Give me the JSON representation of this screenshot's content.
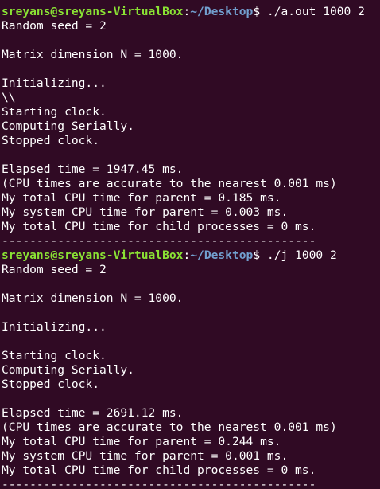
{
  "colors": {
    "background": "#300a24",
    "text": "#ffffff",
    "prompt_user": "#8ae234",
    "prompt_path": "#729fcf"
  },
  "terminal": {
    "runs": [
      {
        "prompt": {
          "user_host": "sreyans@sreyans-VirtualBox",
          "colon": ":",
          "path": "~/Desktop",
          "symbol": "$",
          "command": " ./a.out 1000 2"
        },
        "output": [
          "Random seed = 2",
          "",
          "Matrix dimension N = 1000.",
          "",
          "Initializing...",
          "\\\\",
          "Starting clock.",
          "Computing Serially.",
          "Stopped clock.",
          "",
          "Elapsed time = 1947.45 ms.",
          "(CPU times are accurate to the nearest 0.001 ms)",
          "My total CPU time for parent = 0.185 ms.",
          "My system CPU time for parent = 0.003 ms.",
          "My total CPU time for child processes = 0 ms.",
          "---------------------------------------------"
        ]
      },
      {
        "prompt": {
          "user_host": "sreyans@sreyans-VirtualBox",
          "colon": ":",
          "path": "~/Desktop",
          "symbol": "$",
          "command": " ./j 1000 2"
        },
        "output": [
          "Random seed = 2",
          "",
          "Matrix dimension N = 1000.",
          "",
          "Initializing...",
          "",
          "Starting clock.",
          "Computing Serially.",
          "Stopped clock.",
          "",
          "Elapsed time = 2691.12 ms.",
          "(CPU times are accurate to the nearest 0.001 ms)",
          "My total CPU time for parent = 0.244 ms.",
          "My system CPU time for parent = 0.001 ms.",
          "My total CPU time for child processes = 0 ms.",
          "---------------------------------------------"
        ]
      }
    ]
  }
}
